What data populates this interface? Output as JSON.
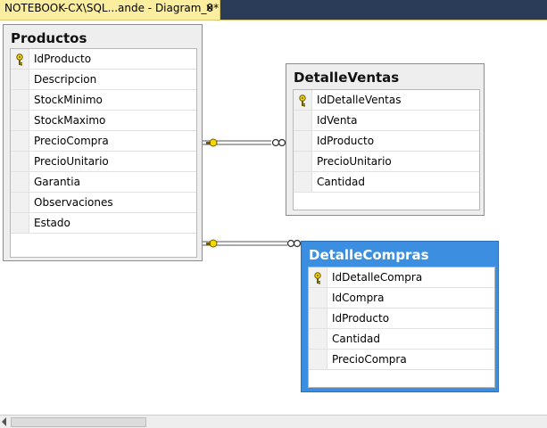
{
  "tab": {
    "title": "NOTEBOOK-CX\\SQL...ande - Diagram_0*",
    "close": "✕"
  },
  "tables": {
    "productos": {
      "name": "Productos",
      "columns": [
        "IdProducto",
        "Descripcion",
        "StockMinimo",
        "StockMaximo",
        "PrecioCompra",
        "PrecioUnitario",
        "Garantia",
        "Observaciones",
        "Estado"
      ],
      "primary_key": "IdProducto"
    },
    "detalle_ventas": {
      "name": "DetalleVentas",
      "columns": [
        "IdDetalleVentas",
        "IdVenta",
        "IdProducto",
        "PrecioUnitario",
        "Cantidad"
      ],
      "primary_key": "IdDetalleVentas"
    },
    "detalle_compras": {
      "name": "DetalleCompras",
      "columns": [
        "IdDetalleCompra",
        "IdCompra",
        "IdProducto",
        "Cantidad",
        "PrecioCompra"
      ],
      "primary_key": "IdDetalleCompra",
      "selected": true
    }
  },
  "icons": {
    "key": "key-icon",
    "one_end": "key-icon",
    "many_end": "infinity-icon"
  },
  "colors": {
    "selected_header": "#3c8fe0",
    "tab_active": "#fbee9e",
    "tab_strip": "#2b3c59"
  }
}
